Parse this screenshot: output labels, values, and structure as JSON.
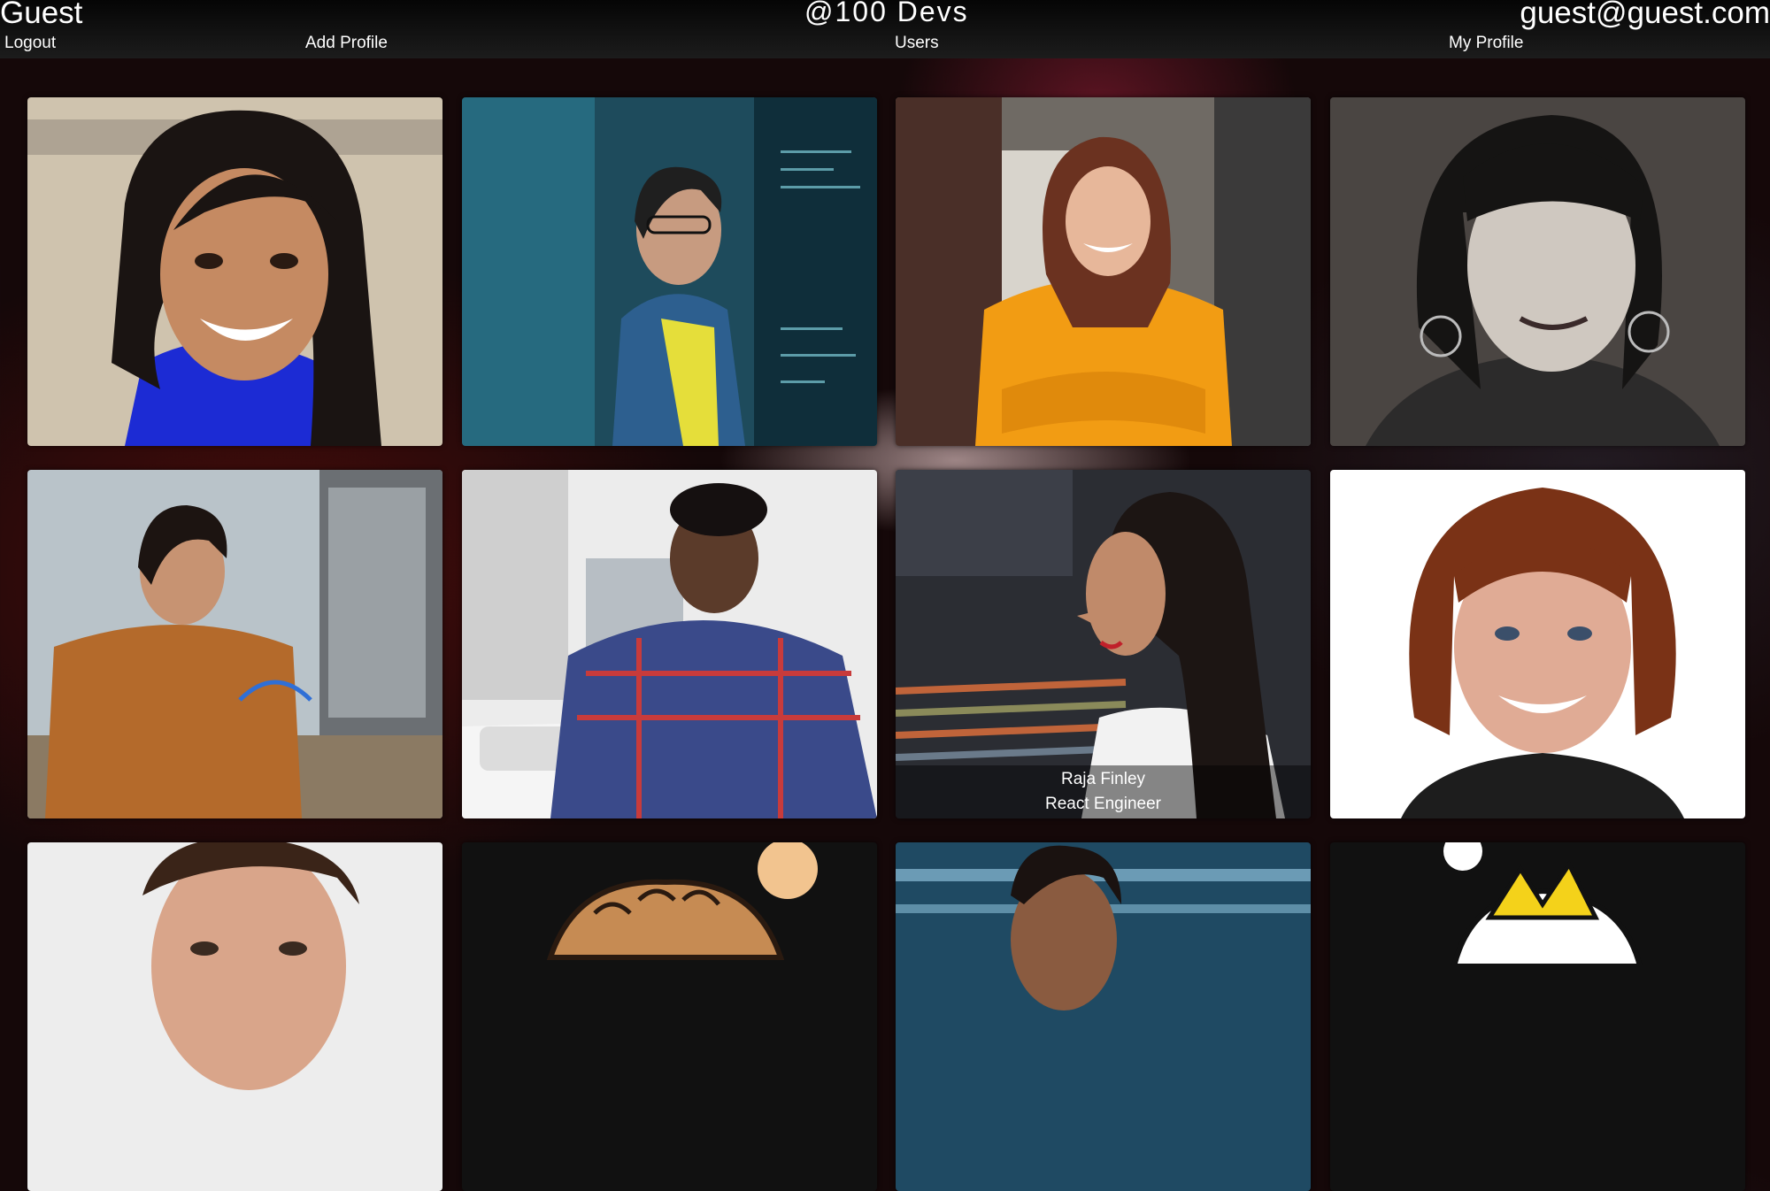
{
  "header": {
    "user_name": "Guest",
    "brand": "@100 Devs",
    "email": "guest@guest.com",
    "nav": {
      "logout": "Logout",
      "add_profile": "Add Profile",
      "users": "Users",
      "my_profile": "My Profile"
    }
  },
  "profiles": [
    {
      "photo": "woman-blue-top-portrait"
    },
    {
      "photo": "woman-glasses-screen-reflection"
    },
    {
      "photo": "woman-orange-top-arms-crossed"
    },
    {
      "photo": "woman-black-white-portrait"
    },
    {
      "photo": "man-repairing-computer"
    },
    {
      "photo": "man-plaid-shirt-keyboard"
    },
    {
      "photo": "woman-profile-looking-up",
      "name": "Raja Finley",
      "title": "React Engineer"
    },
    {
      "photo": "woman-short-auburn-hair"
    },
    {
      "photo": "man-portrait-partial"
    },
    {
      "photo": "cartoon-avatar-curly-hair"
    },
    {
      "photo": "man-portrait-office-partial"
    },
    {
      "photo": "cartoon-avatar-crown"
    }
  ]
}
